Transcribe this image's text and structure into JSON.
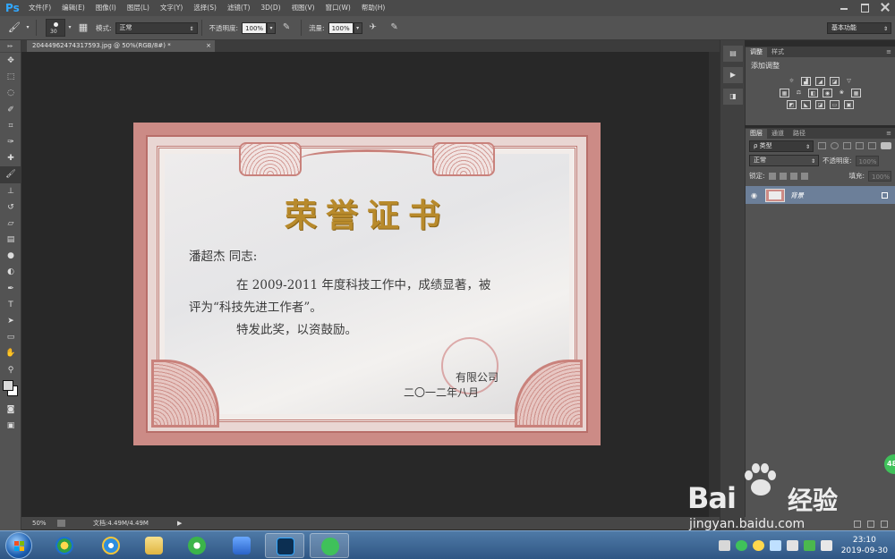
{
  "app": {
    "logo": "Ps"
  },
  "menu": [
    "文件(F)",
    "编辑(E)",
    "图像(I)",
    "图层(L)",
    "文字(Y)",
    "选择(S)",
    "滤镜(T)",
    "3D(D)",
    "视图(V)",
    "窗口(W)",
    "帮助(H)"
  ],
  "options": {
    "brush_size": "30",
    "mode_label": "模式:",
    "mode_value": "正常",
    "opacity_label": "不透明度:",
    "opacity_value": "100%",
    "flow_label": "流量:",
    "flow_value": "100%",
    "workspace": "基本功能"
  },
  "document": {
    "tab_title": "20444962474317593.jpg @ 50%(RGB/8#) *",
    "close_glyph": "×",
    "zoom": "50%",
    "doc_info": "文档:4.49M/4.49M"
  },
  "certificate": {
    "title": "荣誉证书",
    "recipient": "潘超杰  同志:",
    "body_line1": "在 2009-2011 年度科技工作中，成绩显著，被",
    "body_line2": "评为“科技先进工作者”。",
    "body_line3": "特发此奖，以资鼓励。",
    "company": "有限公司",
    "date": "二〇一二年八月"
  },
  "adjust_panel": {
    "tabs": [
      "调整",
      "样式"
    ],
    "title": "添加调整"
  },
  "layers_panel": {
    "tabs": [
      "图层",
      "通道",
      "路径"
    ],
    "filter_type": "ρ 类型",
    "blend_mode": "正常",
    "opacity_label": "不透明度:",
    "opacity_value": "100%",
    "lock_label": "锁定:",
    "fill_label": "填充:",
    "fill_value": "100%",
    "layers": [
      {
        "name": "背景"
      }
    ]
  },
  "badge": "48",
  "watermark": {
    "brand": "Bai",
    "brand_cn": "经验",
    "url": "jingyan.baidu.com"
  },
  "taskbar": {
    "time": "23:10",
    "date": "2019-09-30"
  },
  "colors": {
    "ps_blue": "#31a8ff",
    "certificate_frame": "#cc8b86",
    "certificate_gold": "#b88a2b",
    "selected_layer": "#6c7f99"
  }
}
